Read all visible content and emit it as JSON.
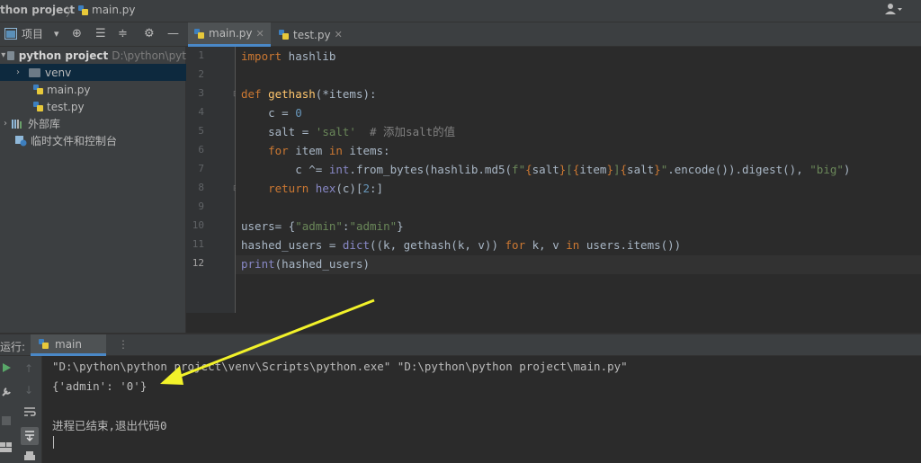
{
  "breadcrumb": {
    "project": "thon project",
    "separator": "〉",
    "file": "main.py"
  },
  "project_toolbar": {
    "label": "项目",
    "dropdown": "▾",
    "target": "⊕",
    "expand": "☰",
    "collapse": "≑",
    "gear": "⚙",
    "hide": "—"
  },
  "tabs": [
    {
      "label": "main.py",
      "close": "✕",
      "active": true
    },
    {
      "label": "test.py",
      "close": "✕",
      "active": false
    }
  ],
  "tree": {
    "project_name": "python project",
    "project_path": "D:\\python\\pyt",
    "venv": "venv",
    "main": "main.py",
    "test": "test.py",
    "external": "外部库",
    "scratches": "临时文件和控制台"
  },
  "line_numbers": [
    "1",
    "2",
    "3",
    "4",
    "5",
    "6",
    "7",
    "8",
    "9",
    "10",
    "11",
    "12"
  ],
  "code": {
    "l1_kw": "import",
    "l1_rest": " hashlib",
    "l3_kw": "def",
    "l3_sp": " ",
    "l3_fn": "gethash",
    "l3_rest": "(*items):",
    "l4_pre": "    c = ",
    "l4_num": "0",
    "l5_pre": "    salt = ",
    "l5_str": "'salt'",
    "l5_comment": "  # 添加salt的值",
    "l6_kw1": "    for",
    "l6_mid": " item ",
    "l6_kw2": "in",
    "l6_rest": " items:",
    "l7_pre": "        c ^= ",
    "l7_int": "int",
    "l7_a": ".from_bytes(hashlib.md5(",
    "l7_fstr1": "f\"",
    "l7_b1": "{",
    "l7_v1": "salt",
    "l7_b2": "}",
    "l7_s1": "[",
    "l7_b3": "{",
    "l7_v2": "item",
    "l7_b4": "}",
    "l7_s2": "]",
    "l7_b5": "{",
    "l7_v3": "salt",
    "l7_b6": "}",
    "l7_fstr2": "\"",
    "l7_c": ".encode()).digest(), ",
    "l7_big": "\"big\"",
    "l7_d": ")",
    "l8_kw": "    return",
    "l8_sp": " ",
    "l8_hex": "hex",
    "l8_a": "(c)[",
    "l8_num": "2",
    "l8_b": ":]",
    "l10_pre": "users= {",
    "l10_s1": "\"admin\"",
    "l10_colon": ":",
    "l10_s2": "\"admin\"",
    "l10_post": "}",
    "l11_pre": "hashed_users = ",
    "l11_dict": "dict",
    "l11_a": "((k, gethash(k, v)) ",
    "l11_for": "for",
    "l11_b": " k, v ",
    "l11_in": "in",
    "l11_c": " users.items())",
    "l12_print": "print",
    "l12_rest": "(hashed_users)"
  },
  "run": {
    "label": "运行:",
    "tab": "main",
    "more": "⋮",
    "output": [
      "\"D:\\python\\python project\\venv\\Scripts\\python.exe\" \"D:\\python\\python project\\main.py\"",
      "{'admin': '0'}",
      "",
      "进程已结束,退出代码0"
    ]
  },
  "colors": {
    "accent": "#4a88c7",
    "annotation_arrow": "#f2f22a"
  }
}
